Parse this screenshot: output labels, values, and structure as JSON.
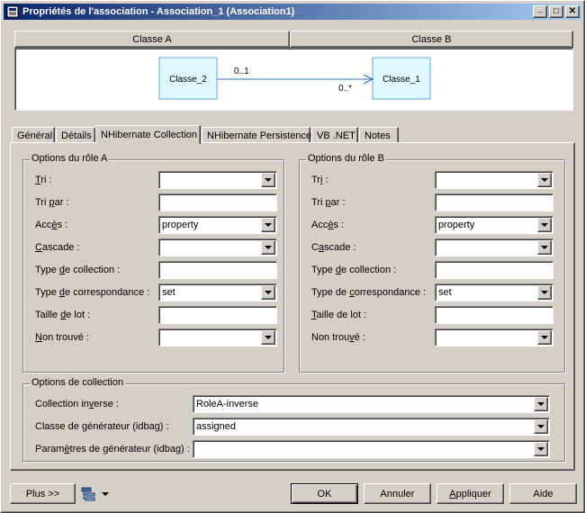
{
  "window": {
    "title": "Propriétés de l'association - Association_1 (Association1)"
  },
  "titlebar_buttons": {
    "minimize": "_",
    "maximize": "□",
    "close": "✕"
  },
  "header": {
    "class_a": "Classe A",
    "class_b": "Classe B"
  },
  "diagram": {
    "left_class": "Classe_2",
    "right_class": "Classe_1",
    "mult_left": "0..1",
    "mult_right": "0..*",
    "class_fill": "#e0f8ff",
    "class_border": "#5aa9e6",
    "line_color": "#1e74c8"
  },
  "tabs": [
    {
      "label": "Général"
    },
    {
      "label": "Détails"
    },
    {
      "label": "NHibernate Collection"
    },
    {
      "label": "NHibernate Persistence"
    },
    {
      "label": "VB .NET"
    },
    {
      "label": "Notes"
    }
  ],
  "role_a": {
    "title": "Options du rôle A",
    "tri": {
      "pre": "",
      "u": "T",
      "post": "ri :",
      "value": ""
    },
    "tri_par": {
      "pre": "Tri ",
      "u": "p",
      "post": "ar :",
      "value": ""
    },
    "acces": {
      "pre": "Acc",
      "u": "è",
      "post": "s :",
      "value": "property"
    },
    "cascade": {
      "pre": "",
      "u": "C",
      "post": "ascade :",
      "value": ""
    },
    "type_collection": {
      "pre": "Type ",
      "u": "d",
      "post": "e collection :",
      "value": ""
    },
    "type_correspondance": {
      "pre": "Type ",
      "u": "d",
      "post": "e correspondance :",
      "value": "set"
    },
    "taille_lot": {
      "pre": "Taille ",
      "u": "d",
      "post": "e lot :",
      "value": ""
    },
    "non_trouve": {
      "pre": "",
      "u": "N",
      "post": "on trouvé :",
      "value": ""
    }
  },
  "role_b": {
    "title": "Options du rôle B",
    "tri": {
      "pre": "Tr",
      "u": "i",
      "post": " :",
      "value": ""
    },
    "tri_par": {
      "pre": "Tri ",
      "u": "p",
      "post": "ar :",
      "value": ""
    },
    "acces": {
      "pre": "Acc",
      "u": "è",
      "post": "s :",
      "value": "property"
    },
    "cascade": {
      "pre": "C",
      "u": "a",
      "post": "scade :",
      "value": ""
    },
    "type_collection": {
      "pre": "Type ",
      "u": "d",
      "post": "e collection :",
      "value": ""
    },
    "type_correspondance": {
      "pre": "Type de ",
      "u": "c",
      "post": "orrespondance :",
      "value": "set"
    },
    "taille_lot": {
      "pre": "",
      "u": "T",
      "post": "aille de lot :",
      "value": ""
    },
    "non_trouve": {
      "pre": "Non trou",
      "u": "v",
      "post": "é :",
      "value": ""
    }
  },
  "collection": {
    "title": "Options de collection",
    "inverse": {
      "pre": "Collection in",
      "u": "v",
      "post": "erse :",
      "value": "RoleA-inverse"
    },
    "generator_class": {
      "pre": "Classe de générateur (idbag) :",
      "u": "",
      "post": "",
      "value": "assigned"
    },
    "generator_params": {
      "pre": "Param",
      "u": "è",
      "post": "tres de générateur (idbag) :",
      "value": ""
    }
  },
  "footer": {
    "more": "Plus >>",
    "ok": "OK",
    "cancel": "Annuler",
    "apply_pre": "",
    "apply_u": "A",
    "apply_post": "ppliquer",
    "help": "Aide"
  }
}
